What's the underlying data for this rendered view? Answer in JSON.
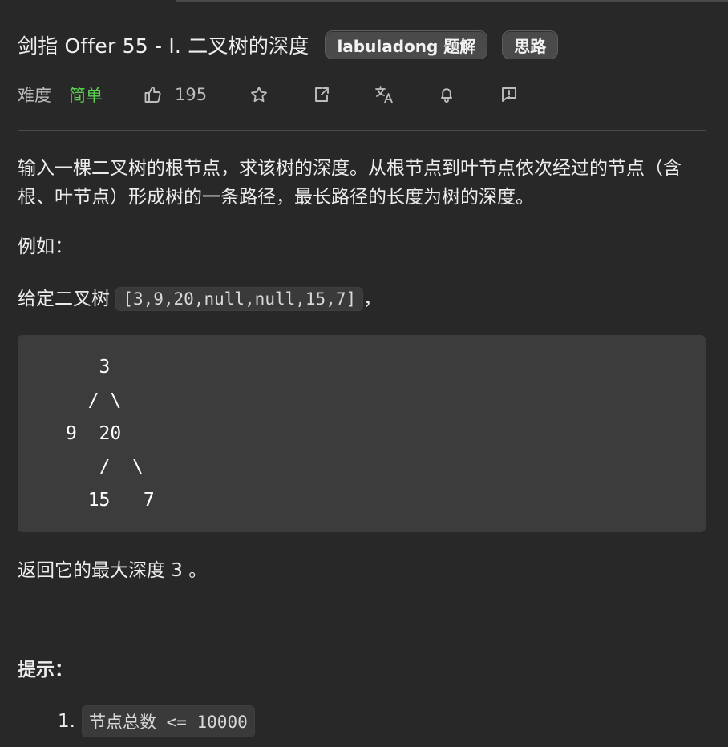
{
  "problem": {
    "title": "剑指 Offer 55 - I. 二叉树的深度",
    "tags": [
      {
        "label": "labuladong 题解"
      },
      {
        "label": "思路"
      }
    ]
  },
  "meta": {
    "difficulty_label": "难度",
    "difficulty_value": "简单",
    "likes": "195",
    "icons": [
      "thumbs-up-icon",
      "star-icon",
      "share-icon",
      "translate-icon",
      "bell-icon",
      "feedback-icon"
    ],
    "accent_green": "#5ccf52"
  },
  "content": {
    "p1": "输入一棵二叉树的根节点，求该树的深度。从根节点到叶节点依次经过的节点（含根、叶节点）形成树的一条路径，最长路径的长度为树的深度。",
    "p2": "例如：",
    "p3_prefix": "给定二叉树",
    "p3_code": "[3,9,20,null,null,15,7]",
    "p3_suffix": "，",
    "code_block": "   3\n  / \\\n9  20\n   /  \\\n  15   7",
    "p4": "返回它的最大深度 3 。",
    "hint_title": "提示：",
    "list": [
      {
        "num": "1.",
        "text_prefix": "节点总数",
        "text_code": " <= 10000"
      }
    ]
  }
}
